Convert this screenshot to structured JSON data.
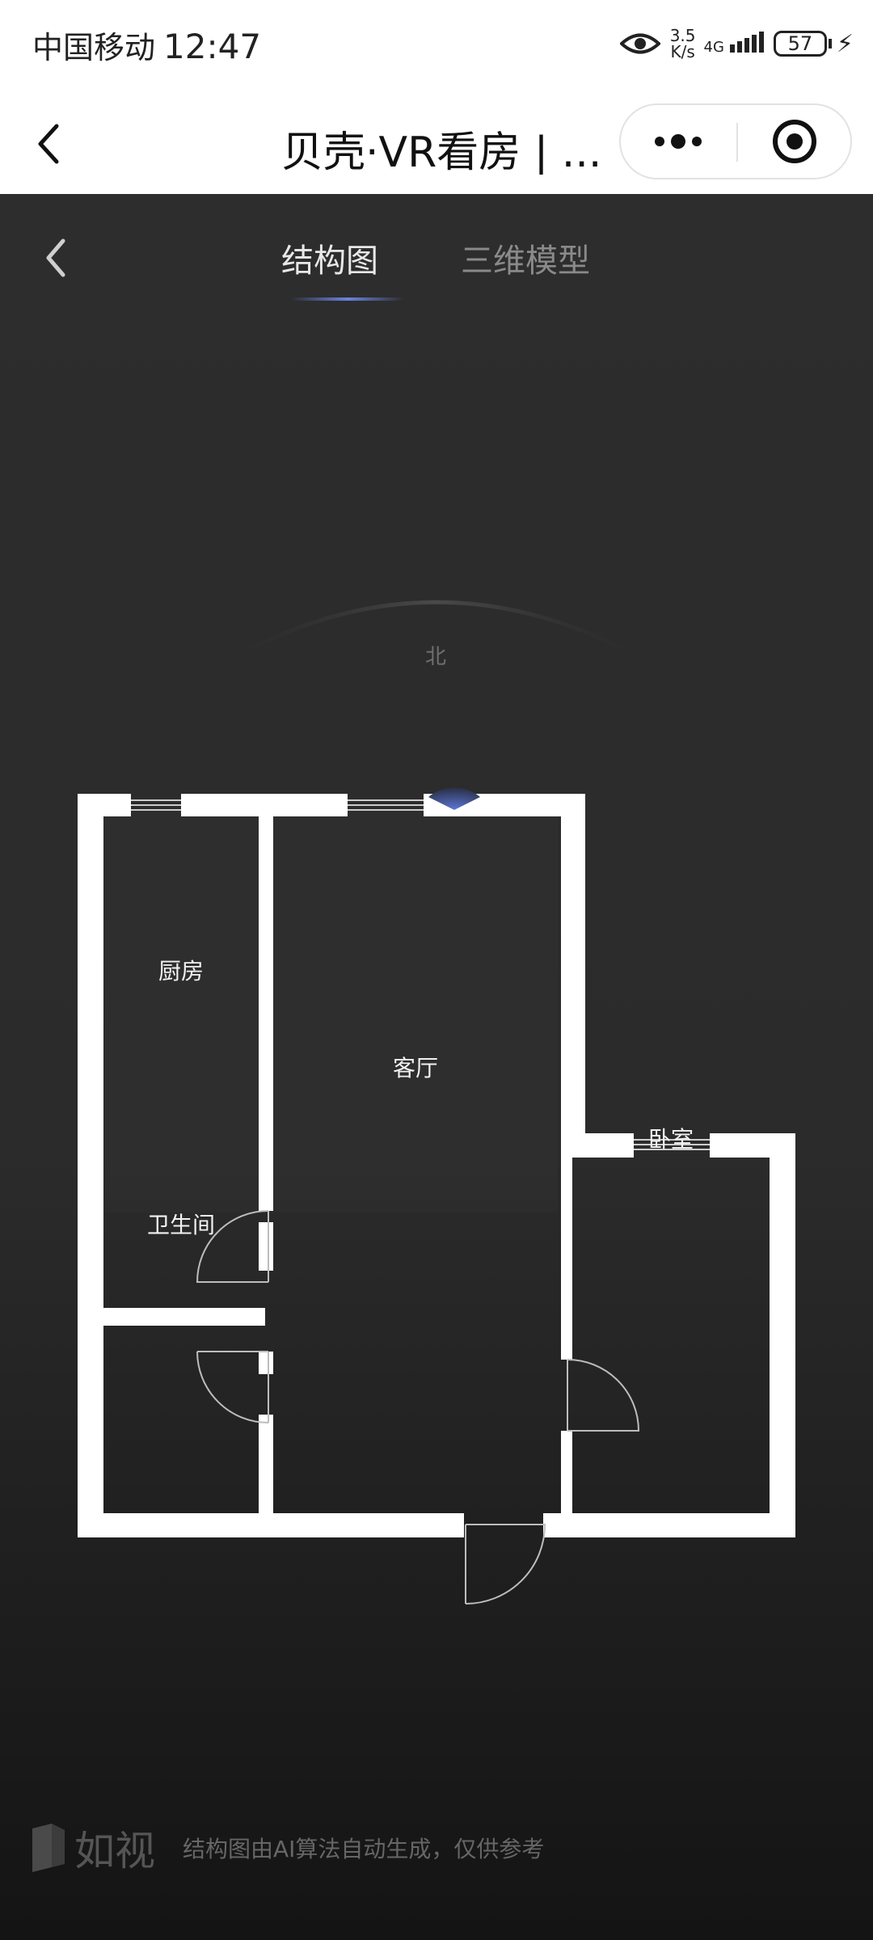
{
  "status_bar": {
    "carrier": "中国移动",
    "time": "12:47",
    "speed_value": "3.5",
    "speed_unit": "K/s",
    "network": "4G",
    "battery": "57"
  },
  "mini_header": {
    "title": "贝壳·VR看房 | ...",
    "icons": {
      "back": "chevron-left-icon",
      "more": "more-dots-icon",
      "close": "target-circle-icon"
    }
  },
  "tabs": [
    {
      "label": "结构图",
      "active": true
    },
    {
      "label": "三维模型",
      "active": false
    }
  ],
  "compass": {
    "label": "北"
  },
  "rooms": [
    {
      "name": "厨房"
    },
    {
      "name": "客厅"
    },
    {
      "name": "卫生间"
    },
    {
      "name": "卧室"
    }
  ],
  "footer": {
    "brand": "如视",
    "note": "结构图由AI算法自动生成，仅供参考"
  },
  "colors": {
    "background": "#2a2a2a",
    "wall": "#ffffff",
    "tab_active": "#e8e8e8",
    "tab_inactive": "#8a8a8a",
    "accent": "#6a82e0"
  }
}
